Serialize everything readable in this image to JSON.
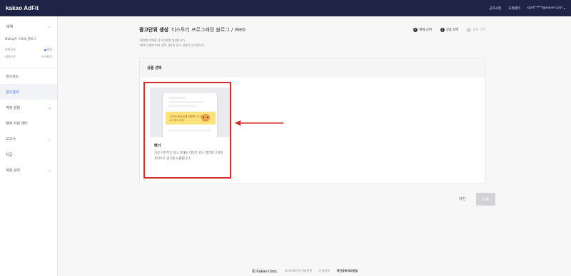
{
  "header": {
    "logo": "kakao AdFit",
    "nav": [
      "공지사항",
      "고객센터"
    ],
    "account": "sprit*****@naver.com"
  },
  "sidebar": {
    "site_selector": "매체",
    "site_name": "Going가 스토리 블로그",
    "rows": [
      {
        "label": "매체상태",
        "value": "정상"
      },
      {
        "label": "매체유형",
        "value": "티스토리"
      }
    ],
    "menu": [
      {
        "label": "대시보드",
        "chevron": false,
        "active": false
      },
      {
        "label": "광고관리",
        "chevron": false,
        "active": true
      },
      {
        "label": "계정 설정",
        "chevron": true,
        "active": false
      },
      {
        "label": "매체 지원 센터",
        "chevron": false,
        "active": false
      },
      {
        "label": "보고서",
        "chevron": true,
        "active": false
      },
      {
        "label": "지급",
        "chevron": false,
        "active": false
      },
      {
        "label": "계정 관리",
        "chevron": true,
        "active": false
      }
    ]
  },
  "page": {
    "title": "광고단위 생성",
    "subtitle": "티스토리 프로그래밍 블로그 / Web",
    "steps": [
      {
        "label": "매체 선택",
        "state": "done",
        "icon": "✔"
      },
      {
        "label": "상품 선택",
        "state": "current",
        "icon": "2"
      },
      {
        "label": "정보 입력",
        "state": "todo",
        "icon": "3"
      }
    ],
    "desc_lines": [
      "·매체에 게재할 광고단위를 생성합니다.",
      "·매체 유형에 따라 선택 가능한 광고 상품이 상이합니다."
    ]
  },
  "panel": {
    "heading": "상품 선택",
    "card": {
      "banner_text": "지겨운 퇴근길에 뭐할까? 카카오 뭐사 오픈!",
      "title": "배너",
      "desc": "가장 기본적인 광고 형태로 적당한 광고 영역에 고정된 사이즈로 광고를 노출합니다."
    }
  },
  "buttons": {
    "prev": "이전",
    "next": "다음"
  },
  "footer": {
    "brand": "Ⓚ Kakao Corp.",
    "links": [
      "카카오애드핏 이용약관",
      "운영정책"
    ],
    "strong_link": "개인정보처리방침"
  },
  "colors": {
    "topbar": "#1e2445",
    "highlight": "#d72a2a",
    "active_menu": "#3366ff"
  }
}
